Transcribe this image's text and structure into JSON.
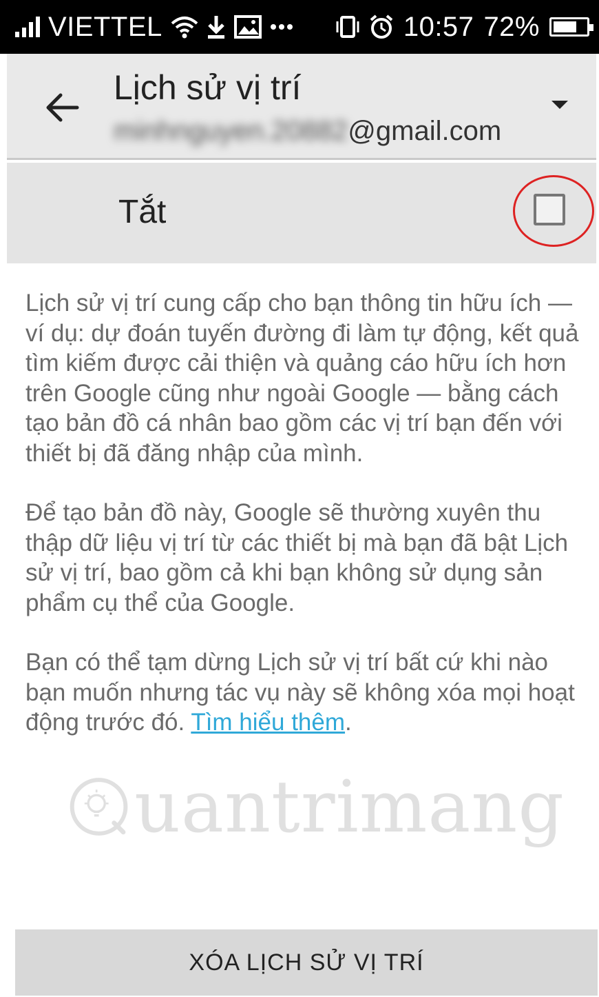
{
  "status_bar": {
    "carrier": "VIETTEL",
    "time": "10:57",
    "battery": "72%",
    "battery_level": 0.72,
    "icons": [
      "signal-icon",
      "wifi-icon",
      "download-icon",
      "image-icon",
      "more-icon",
      "vibrate-icon",
      "alarm-icon",
      "battery-icon"
    ]
  },
  "app_bar": {
    "title": "Lịch sử vị trí",
    "email_blurred": "minhnguyen.20882",
    "email_suffix": "@gmail.com"
  },
  "toggle": {
    "label": "Tắt",
    "checked": false
  },
  "content": {
    "paragraph1": "Lịch sử vị trí cung cấp cho bạn thông tin hữu ích — ví dụ: dự đoán tuyến đường đi làm tự động, kết quả tìm kiếm được cải thiện và quảng cáo hữu ích hơn trên Google cũng như ngoài Google — bằng cách tạo bản đồ cá nhân bao gồm các vị trí bạn đến với thiết bị đã đăng nhập của mình.",
    "paragraph2": "Để tạo bản đồ này, Google sẽ thường xuyên thu thập dữ liệu vị trí từ các thiết bị mà bạn đã bật Lịch sử vị trí, bao gồm cả khi bạn không sử dụng sản phẩm cụ thể của Google.",
    "paragraph3": "Bạn có thể tạm dừng Lịch sử vị trí bất cứ khi nào bạn muốn nhưng tác vụ này sẽ không xóa mọi hoạt động trước đó.",
    "learn_more": "Tìm hiểu thêm",
    "period": "."
  },
  "watermark": {
    "text": "uantrimang"
  },
  "bottom_button": {
    "label": "XÓA LỊCH SỬ VỊ TRÍ"
  }
}
